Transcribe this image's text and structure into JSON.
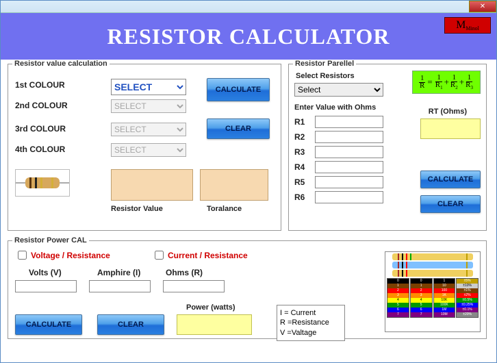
{
  "app_title": "RESISTOR CALCULATOR",
  "logo_text": "Minol",
  "logo_letter": "M",
  "groups": {
    "value_calc": {
      "legend": "Resistor value calculation",
      "color_labels": [
        "1st COLOUR",
        "2nd COLOUR",
        "3rd COLOUR",
        "4th COLOUR"
      ],
      "select_option": "SELECT",
      "calculate": "CALCULATE",
      "clear": "CLEAR",
      "result_labels": {
        "value": "Resistor Value",
        "tolerance": "Toralance"
      }
    },
    "parallel": {
      "legend": "Resistor Parellel",
      "select_label": "Select Resistors",
      "select_option": "Select",
      "enter_label": "Enter Value with Ohms",
      "rows": [
        "R1",
        "R2",
        "R3",
        "R4",
        "R5",
        "R6"
      ],
      "rt_label": "RT (Ohms)",
      "calculate": "CALCULATE",
      "clear": "CLEAR",
      "formula": {
        "lhs_n": "1",
        "lhs_d": "R",
        "t1_n": "1",
        "t1_d": "R",
        "t1_s": "1",
        "t2_n": "1",
        "t2_d": "R",
        "t2_s": "2",
        "t3_n": "1",
        "t3_d": "R",
        "t3_s": "3"
      }
    },
    "power": {
      "legend": "Resistor Power CAL",
      "opt_vr": "Voltage / Resistance",
      "opt_cr": "Current / Resistance",
      "volts": "Volts (V)",
      "amps": "Amphire (I)",
      "ohms": "Ohms (R)",
      "power": "Power (watts)",
      "calculate": "CALCULATE",
      "clear": "CLEAR",
      "legend_box": {
        "l1": "I = Current",
        "l2": "R =Resistance",
        "l3": "V =Valtage"
      }
    }
  }
}
